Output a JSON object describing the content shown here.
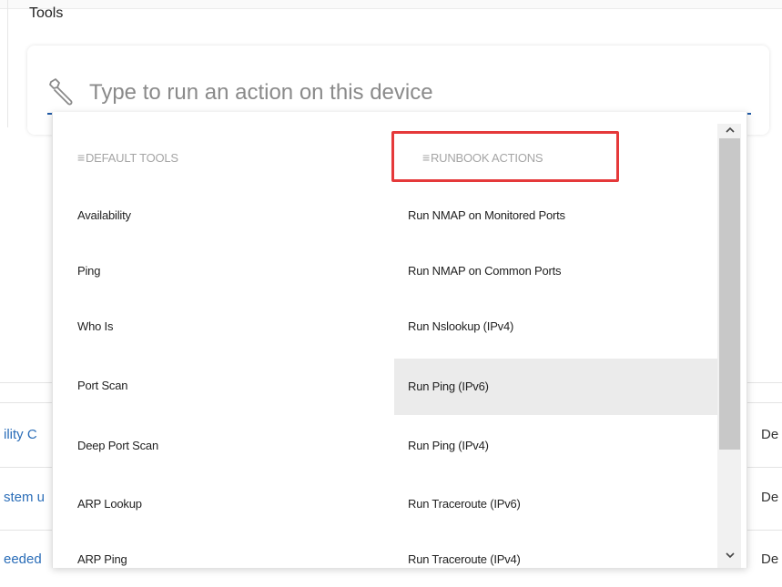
{
  "page": {
    "title": "Tools"
  },
  "search": {
    "placeholder": "Type to run an action on this device",
    "value": ""
  },
  "background": {
    "links": [
      "ility C",
      "stem u",
      "eeded"
    ],
    "right_text": [
      "De",
      "De",
      "De"
    ]
  },
  "dropdown": {
    "default_tools": {
      "header": "DEFAULT TOOLS",
      "items": [
        "Availability",
        "Ping",
        "Who Is",
        "Port Scan",
        "Deep Port Scan",
        "ARP Lookup",
        "ARP Ping"
      ]
    },
    "runbook_actions": {
      "header": "RUNBOOK ACTIONS",
      "items": [
        "Run NMAP on Monitored Ports",
        "Run NMAP on Common Ports",
        "Run Nslookup (IPv4)",
        "Run Ping (IPv6)",
        "Run Ping (IPv4)",
        "Run Traceroute (IPv6)",
        "Run Traceroute (IPv4)"
      ],
      "hovered_item": "Run Ping (IPv6)"
    },
    "header_icon": "≡"
  },
  "colors": {
    "accent": "#1f5aa6",
    "annotation": "#e5393a",
    "hover": "#ebebeb",
    "link": "#2a6db8"
  },
  "icons": {
    "search": "wrench-icon",
    "scroll_up": "chevron-up-icon",
    "scroll_down": "chevron-down-icon"
  }
}
